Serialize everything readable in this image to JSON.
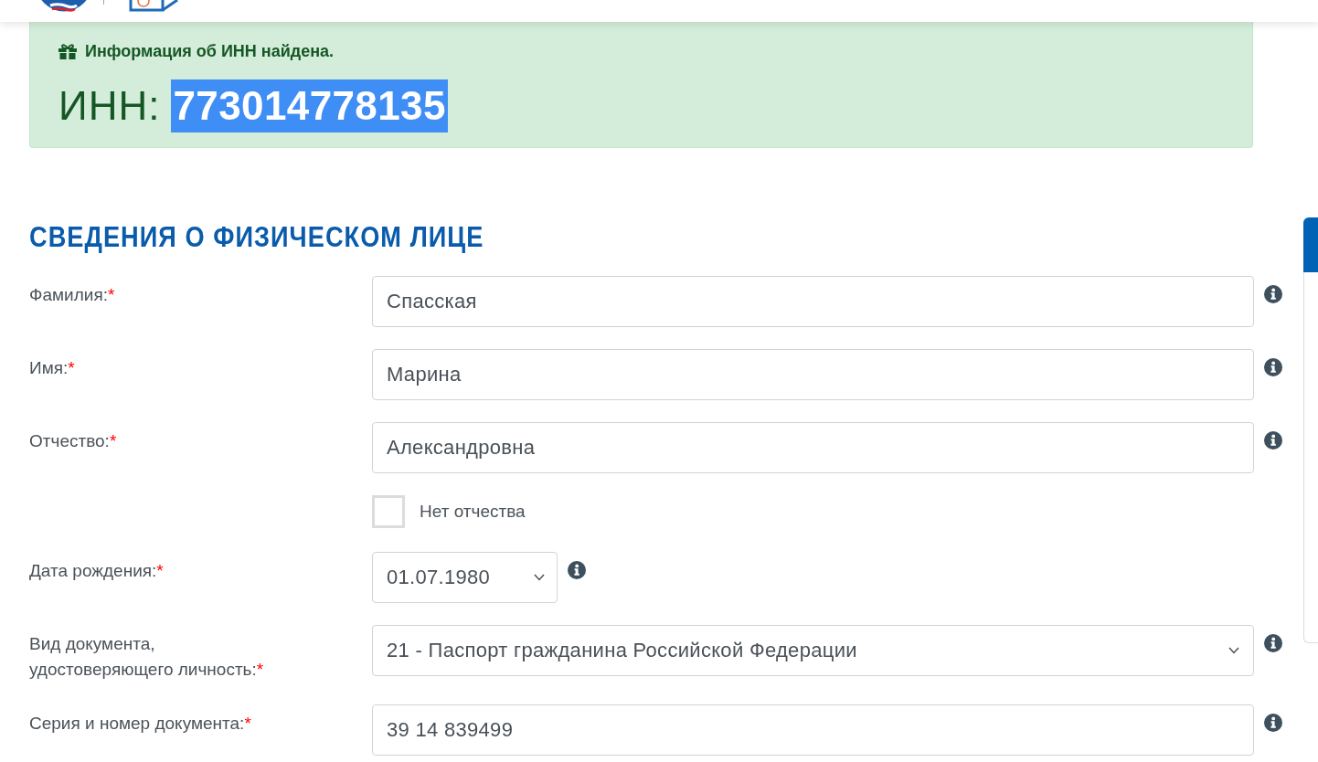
{
  "alert": {
    "message": "Информация об ИНН найдена.",
    "inn_label": "ИНН:",
    "inn_value": "773014778135",
    "inn_value_highlighted": true
  },
  "section": {
    "title": "СВЕДЕНИЯ О ФИЗИЧЕСКОМ ЛИЦЕ",
    "fields": [
      {
        "kind": "text",
        "label": "Фамилия:",
        "required_mark": "*",
        "value": "Спасская"
      },
      {
        "kind": "text",
        "label": "Имя:",
        "required_mark": "*",
        "value": "Марина"
      },
      {
        "kind": "text",
        "label": "Отчество:",
        "required_mark": "*",
        "value": "Александровна"
      },
      {
        "kind": "checkbox",
        "label": "Нет отчества",
        "checked": false
      },
      {
        "kind": "date",
        "label": "Дата рождения:",
        "required_mark": "*",
        "value": "01.07.1980"
      },
      {
        "kind": "select",
        "label": "Вид документа, удостоверяющего личность:",
        "required_mark": "*",
        "value": "21 - Паспорт гражданина Российской Федерации"
      },
      {
        "kind": "text",
        "label": "Серия и номер документа:",
        "required_mark": "*",
        "value": "39 14 839499"
      }
    ]
  }
}
